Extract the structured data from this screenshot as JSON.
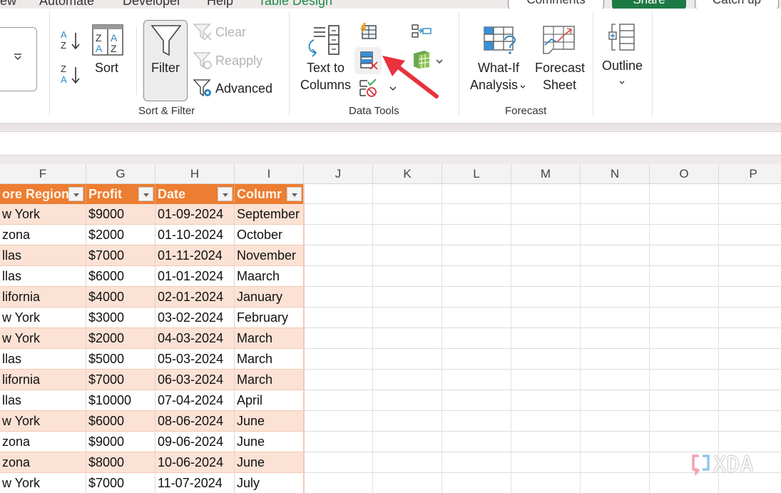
{
  "tabs": {
    "items": [
      {
        "label": "ew"
      },
      {
        "label": "Automate"
      },
      {
        "label": "Developer"
      },
      {
        "label": "Help"
      },
      {
        "label": "Table Design",
        "active": true
      }
    ],
    "right_buttons": [
      {
        "label": "Comments"
      },
      {
        "label": "Share"
      },
      {
        "label": "Catch up"
      }
    ]
  },
  "ribbon": {
    "sort_filter": {
      "group_label": "Sort & Filter",
      "sort_az_icon": "sort-ascending-icon",
      "sort_za_icon": "sort-descending-icon",
      "sort_label": "Sort",
      "filter_label": "Filter",
      "clear_label": "Clear",
      "reapply_label": "Reapply",
      "advanced_label": "Advanced"
    },
    "data_tools": {
      "group_label": "Data Tools",
      "text_to_columns_line1": "Text to",
      "text_to_columns_line2": "Columns",
      "flash_fill_icon": "flash-fill-icon",
      "remove_duplicates_icon": "remove-duplicates-icon",
      "data_validation_icon": "data-validation-icon",
      "consolidate_icon": "consolidate-icon",
      "data_model_icon": "data-model-icon"
    },
    "forecast": {
      "group_label": "Forecast",
      "what_if_line1": "What-If",
      "what_if_line2": "Analysis",
      "forecast_sheet_line1": "Forecast",
      "forecast_sheet_line2": "Sheet"
    },
    "outline": {
      "label": "Outline"
    }
  },
  "sheet": {
    "columns": [
      "F",
      "G",
      "H",
      "I",
      "J",
      "K",
      "L",
      "M",
      "N",
      "O",
      "P"
    ],
    "table_headers": [
      "ore Region",
      "Profit",
      "Date",
      "Columr"
    ],
    "rows": [
      [
        "w York",
        "$9000",
        "01-09-2024",
        "September"
      ],
      [
        "zona",
        "$2000",
        "01-10-2024",
        "October"
      ],
      [
        "llas",
        "$7000",
        "01-11-2024",
        "November"
      ],
      [
        "llas",
        "$6000",
        "01-01-2024",
        "Maarch"
      ],
      [
        "lifornia",
        "$4000",
        "02-01-2024",
        "January"
      ],
      [
        "w York",
        "$3000",
        "03-02-2024",
        "February"
      ],
      [
        "w York",
        "$2000",
        "04-03-2024",
        "March"
      ],
      [
        "llas",
        "$5000",
        "05-03-2024",
        "March"
      ],
      [
        "lifornia",
        "$7000",
        "06-03-2024",
        "March"
      ],
      [
        "llas",
        "$10000",
        "07-04-2024",
        "April"
      ],
      [
        "w York",
        "$6000",
        "08-06-2024",
        "June"
      ],
      [
        "zona",
        "$9000",
        "09-06-2024",
        "June"
      ],
      [
        "zona",
        "$8000",
        "10-06-2024",
        "June"
      ],
      [
        "w York",
        "$7000",
        "11-07-2024",
        "July"
      ]
    ]
  },
  "watermark": {
    "text": "XDA"
  },
  "colors": {
    "table_header": "#ed7d31",
    "table_band": "#fbe2d5",
    "share_green": "#1e7a45",
    "annotation_arrow": "#e8323c"
  }
}
